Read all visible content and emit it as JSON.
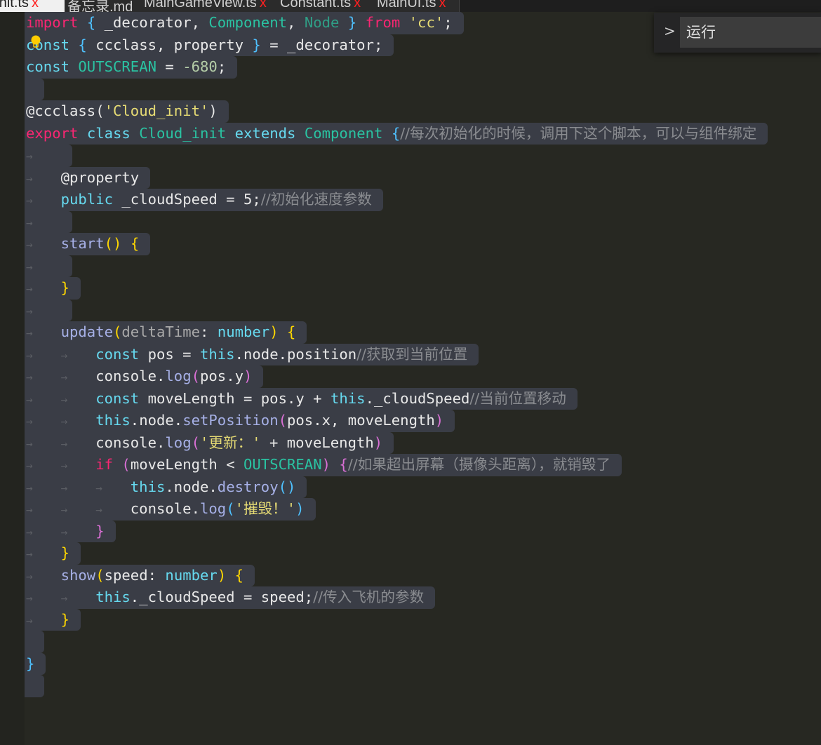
{
  "tabs": [
    {
      "label": "d_init.ts",
      "close": "x",
      "active": true
    },
    {
      "label": "备忘录.md",
      "close": ""
    },
    {
      "label": "MainGameView.ts",
      "close": "x"
    },
    {
      "label": "Constant.ts",
      "close": "x"
    },
    {
      "label": "MainUI.ts",
      "close": "x"
    }
  ],
  "command_palette": {
    "chevron": ">",
    "input_value": "运行"
  },
  "icons": {
    "lightbulb": "lightbulb-icon",
    "tab_arrow": "→"
  },
  "code": {
    "lines": [
      [
        [
          "import",
          "k"
        ],
        [
          " ",
          "p"
        ],
        [
          "{",
          "b"
        ],
        [
          " _decorator, ",
          "p"
        ],
        [
          "Component",
          "t"
        ],
        [
          ", ",
          "p"
        ],
        [
          "Node",
          "t2"
        ],
        [
          " ",
          "p"
        ],
        [
          "}",
          "b"
        ],
        [
          " ",
          "p"
        ],
        [
          "from",
          "k"
        ],
        [
          " ",
          "p"
        ],
        [
          "'cc'",
          "s"
        ],
        [
          ";",
          "p"
        ]
      ],
      [
        [
          "const",
          "c"
        ],
        [
          " ",
          "p"
        ],
        [
          "{",
          "b"
        ],
        [
          " ccclass, property ",
          "p"
        ],
        [
          "}",
          "b"
        ],
        [
          " = _decorator;",
          "p"
        ]
      ],
      [
        [
          "const",
          "c"
        ],
        [
          " ",
          "p"
        ],
        [
          "OUTSCREAN",
          "t"
        ],
        [
          " = ",
          "p"
        ],
        [
          "-680",
          "n"
        ],
        [
          ";",
          "p"
        ]
      ],
      [],
      [
        [
          "@ccclass(",
          "p"
        ],
        [
          "'Cloud_init'",
          "s"
        ],
        [
          ")",
          "p"
        ]
      ],
      [
        [
          "export",
          "k"
        ],
        [
          " ",
          "p"
        ],
        [
          "class",
          "c"
        ],
        [
          " ",
          "p"
        ],
        [
          "Cloud_init",
          "t"
        ],
        [
          " ",
          "p"
        ],
        [
          "extends",
          "c"
        ],
        [
          " ",
          "p"
        ],
        [
          "Component",
          "t"
        ],
        [
          " ",
          "p"
        ],
        [
          "{",
          "b"
        ],
        [
          "//每次初始化的时候，调用下这个脚本，可以与组件绑定",
          "m"
        ]
      ],
      [
        [
          "→",
          "tab"
        ]
      ],
      [
        [
          "→",
          "tab"
        ],
        [
          "@property",
          "p"
        ]
      ],
      [
        [
          "→",
          "tab"
        ],
        [
          "public",
          "c"
        ],
        [
          " _cloudSpeed = 5;",
          "p"
        ],
        [
          "//初始化速度参数",
          "m"
        ]
      ],
      [
        [
          "→",
          "tab"
        ]
      ],
      [
        [
          "→",
          "tab"
        ],
        [
          "start",
          "f"
        ],
        [
          "()",
          "y"
        ],
        [
          " ",
          "p"
        ],
        [
          "{",
          "y"
        ]
      ],
      [
        [
          "→",
          "tab"
        ]
      ],
      [
        [
          "→",
          "tab"
        ],
        [
          "}",
          "y"
        ]
      ],
      [
        [
          "→",
          "tab"
        ]
      ],
      [
        [
          "→",
          "tab"
        ],
        [
          "update",
          "f"
        ],
        [
          "(",
          "y"
        ],
        [
          "deltaTime",
          "a"
        ],
        [
          ": ",
          "p"
        ],
        [
          "number",
          "c"
        ],
        [
          ")",
          "y"
        ],
        [
          " ",
          "p"
        ],
        [
          "{",
          "y"
        ]
      ],
      [
        [
          "→",
          "tab"
        ],
        [
          "→",
          "tab"
        ],
        [
          "const",
          "c"
        ],
        [
          " pos = ",
          "p"
        ],
        [
          "this",
          "c"
        ],
        [
          ".node.position",
          "p"
        ],
        [
          "//获取到当前位置",
          "m"
        ]
      ],
      [
        [
          "→",
          "tab"
        ],
        [
          "→",
          "tab"
        ],
        [
          "console.",
          "p"
        ],
        [
          "log",
          "f"
        ],
        [
          "(",
          "g"
        ],
        [
          "pos.y",
          "p"
        ],
        [
          ")",
          "g"
        ]
      ],
      [
        [
          "→",
          "tab"
        ],
        [
          "→",
          "tab"
        ],
        [
          "const",
          "c"
        ],
        [
          " moveLength = pos.y + ",
          "p"
        ],
        [
          "this",
          "c"
        ],
        [
          "._cloudSpeed",
          "p"
        ],
        [
          "//当前位置移动",
          "m"
        ]
      ],
      [
        [
          "→",
          "tab"
        ],
        [
          "→",
          "tab"
        ],
        [
          "this",
          "c"
        ],
        [
          ".node.",
          "p"
        ],
        [
          "setPosition",
          "f"
        ],
        [
          "(",
          "g"
        ],
        [
          "pos.x, moveLength",
          "p"
        ],
        [
          ")",
          "g"
        ]
      ],
      [
        [
          "→",
          "tab"
        ],
        [
          "→",
          "tab"
        ],
        [
          "console.",
          "p"
        ],
        [
          "log",
          "f"
        ],
        [
          "(",
          "g"
        ],
        [
          "'更新：'",
          "s"
        ],
        [
          " + moveLength",
          "p"
        ],
        [
          ")",
          "g"
        ]
      ],
      [
        [
          "→",
          "tab"
        ],
        [
          "→",
          "tab"
        ],
        [
          "if",
          "k"
        ],
        [
          " ",
          "p"
        ],
        [
          "(",
          "g"
        ],
        [
          "moveLength < ",
          "p"
        ],
        [
          "OUTSCREAN",
          "t"
        ],
        [
          ")",
          "g"
        ],
        [
          " ",
          "p"
        ],
        [
          "{",
          "g"
        ],
        [
          "//如果超出屏幕（摄像头距离），就销毁了",
          "m"
        ]
      ],
      [
        [
          "→",
          "tab"
        ],
        [
          "→",
          "tab"
        ],
        [
          "→",
          "tab"
        ],
        [
          "this",
          "c"
        ],
        [
          ".node.",
          "p"
        ],
        [
          "destroy",
          "f"
        ],
        [
          "()",
          "b"
        ]
      ],
      [
        [
          "→",
          "tab"
        ],
        [
          "→",
          "tab"
        ],
        [
          "→",
          "tab"
        ],
        [
          "console.",
          "p"
        ],
        [
          "log",
          "f"
        ],
        [
          "(",
          "b"
        ],
        [
          "'摧毁！'",
          "s"
        ],
        [
          ")",
          "b"
        ]
      ],
      [
        [
          "→",
          "tab"
        ],
        [
          "→",
          "tab"
        ],
        [
          "}",
          "g"
        ]
      ],
      [
        [
          "→",
          "tab"
        ],
        [
          "}",
          "y"
        ]
      ],
      [
        [
          "→",
          "tab"
        ],
        [
          "show",
          "f"
        ],
        [
          "(",
          "y"
        ],
        [
          "speed",
          "p"
        ],
        [
          ": ",
          "p"
        ],
        [
          "number",
          "c"
        ],
        [
          ")",
          "y"
        ],
        [
          " ",
          "p"
        ],
        [
          "{",
          "y"
        ]
      ],
      [
        [
          "→",
          "tab"
        ],
        [
          "→",
          "tab"
        ],
        [
          "this",
          "c"
        ],
        [
          "._cloudSpeed = speed;",
          "p"
        ],
        [
          "//传入飞机的参数",
          "m"
        ]
      ],
      [
        [
          "→",
          "tab"
        ],
        [
          "}",
          "y"
        ]
      ],
      [],
      [
        [
          "}",
          "b"
        ]
      ],
      []
    ]
  }
}
